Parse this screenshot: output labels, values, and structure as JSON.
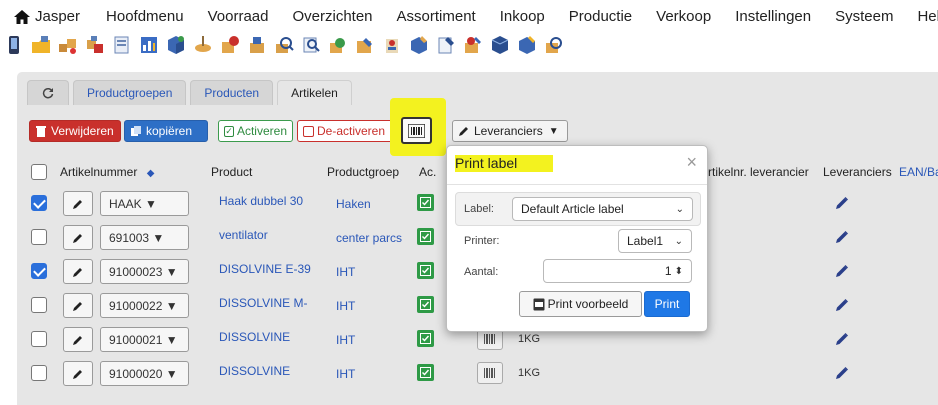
{
  "menu": {
    "home_label": "Jasper",
    "items": [
      "Hoofdmenu",
      "Voorraad",
      "Overzichten",
      "Assortiment",
      "Inkoop",
      "Productie",
      "Verkoop",
      "Instellingen",
      "Systeem",
      "Help"
    ]
  },
  "toolbar_icon_count": 21,
  "tabs": [
    {
      "label": "Productgroepen",
      "active": false
    },
    {
      "label": "Producten",
      "active": false
    },
    {
      "label": "Artikelen",
      "active": true
    }
  ],
  "actions": {
    "delete": "Verwijderen",
    "copy": "kopiëren",
    "activate": "Activeren",
    "deactivate": "De-activeren",
    "suppliers": "Leveranciers"
  },
  "table": {
    "headers": {
      "artikelnummer": "Artikelnummer",
      "product": "Product",
      "productgroep": "Productgroep",
      "actief": "Ac.",
      "artikelnr_leverancier": "rtikelnr. leverancier",
      "leveranciers": "Leveranciers",
      "ean": "EAN/Ba"
    },
    "rows": [
      {
        "checked": true,
        "artnr": "HAAK",
        "product": "Haak dubbel 30",
        "group": "Haken",
        "unit": ""
      },
      {
        "checked": false,
        "artnr": "691003",
        "product": "ventilator",
        "group": "center parcs",
        "unit": ""
      },
      {
        "checked": true,
        "artnr": "91000023",
        "product": "DISOLVINE E-39",
        "group": "IHT",
        "unit": ""
      },
      {
        "checked": false,
        "artnr": "91000022",
        "product": "DISSOLVINE M-",
        "group": "IHT",
        "unit": ""
      },
      {
        "checked": false,
        "artnr": "91000021",
        "product": "DISSOLVINE",
        "group": "IHT",
        "unit": "1KG"
      },
      {
        "checked": false,
        "artnr": "91000020",
        "product": "DISSOLVINE",
        "group": "IHT",
        "unit": "1KG"
      }
    ]
  },
  "modal": {
    "title": "Print label",
    "label_label": "Label:",
    "label_value": "Default Article label",
    "printer_label": "Printer:",
    "printer_value": "Label1",
    "aantal_label": "Aantal:",
    "aantal_value": "1",
    "preview_button": "Print voorbeeld",
    "print_button": "Print"
  },
  "colors": {
    "highlight": "#f3f21f",
    "danger": "#c9302c",
    "primary": "#2d6fc6",
    "success": "#2e9a46",
    "link": "#2a57b8"
  }
}
